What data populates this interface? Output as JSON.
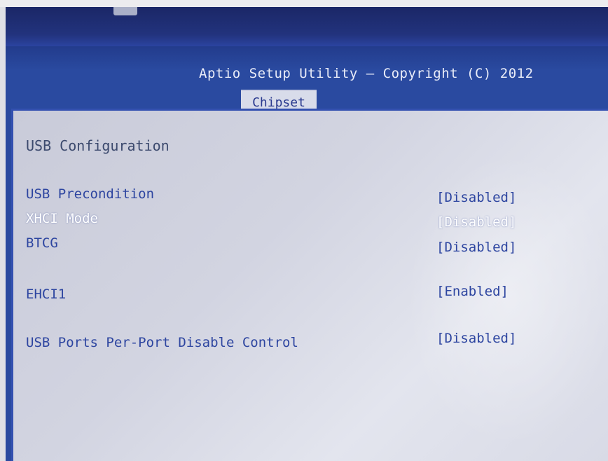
{
  "header": {
    "title": "Aptio Setup Utility – Copyright (C) 2012",
    "active_tab": "Chipset"
  },
  "section": {
    "title": "USB Configuration"
  },
  "settings": [
    {
      "label": "USB Precondition",
      "value": "[Disabled]"
    },
    {
      "label": "XHCI Mode",
      "value": "[Disabled]"
    },
    {
      "label": "BTCG",
      "value": "[Disabled]"
    },
    {
      "label": "EHCI1",
      "value": "[Enabled]"
    },
    {
      "label": "USB Ports Per-Port Disable Control",
      "value": "[Disabled]"
    }
  ],
  "selected_setting": "XHCI Mode",
  "colors": {
    "background_blue": "#2a4aa0",
    "panel_gray": "#d2d4e1",
    "item_blue": "#2d45a0",
    "selected_white": "#ffffff"
  }
}
